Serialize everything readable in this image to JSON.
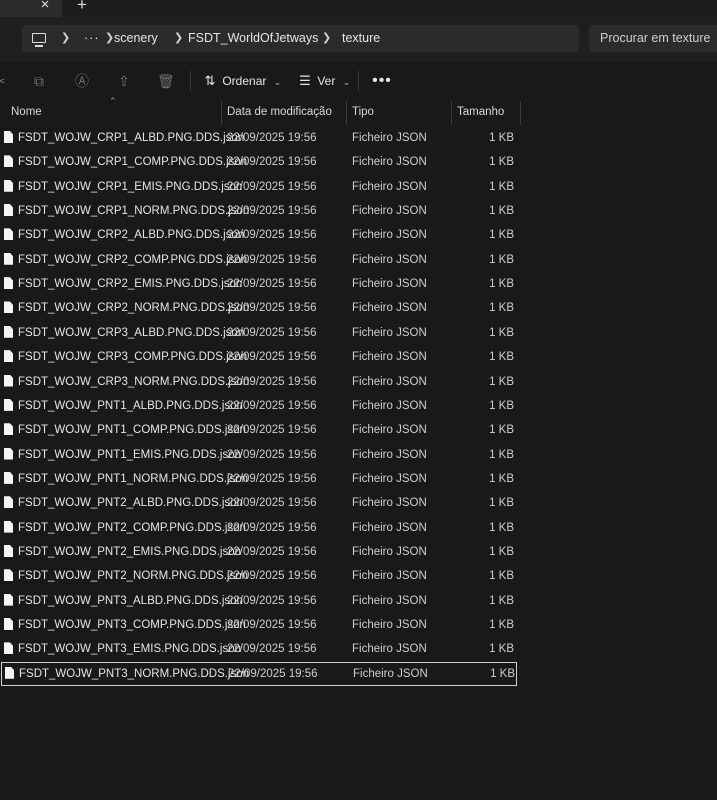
{
  "tabs": {
    "close_glyph": "×",
    "new_glyph": "+"
  },
  "address": {
    "overflow": "···",
    "crumbs": [
      "scenery",
      "FSDT_WorldOfJetways",
      "texture"
    ],
    "search_placeholder": "Procurar em texture"
  },
  "toolbar": {
    "sort_label": "Ordenar",
    "view_label": "Ver",
    "more_label": "•••"
  },
  "columns": {
    "name": "Nome",
    "date": "Data de modificação",
    "type": "Tipo",
    "size": "Tamanho"
  },
  "files": [
    {
      "name": "FSDT_WOJW_CRP1_ALBD.PNG.DDS.json",
      "date": "22/09/2025 19:56",
      "type": "Ficheiro JSON",
      "size": "1 KB"
    },
    {
      "name": "FSDT_WOJW_CRP1_COMP.PNG.DDS.json",
      "date": "22/09/2025 19:56",
      "type": "Ficheiro JSON",
      "size": "1 KB"
    },
    {
      "name": "FSDT_WOJW_CRP1_EMIS.PNG.DDS.json",
      "date": "22/09/2025 19:56",
      "type": "Ficheiro JSON",
      "size": "1 KB"
    },
    {
      "name": "FSDT_WOJW_CRP1_NORM.PNG.DDS.json",
      "date": "22/09/2025 19:56",
      "type": "Ficheiro JSON",
      "size": "1 KB"
    },
    {
      "name": "FSDT_WOJW_CRP2_ALBD.PNG.DDS.json",
      "date": "22/09/2025 19:56",
      "type": "Ficheiro JSON",
      "size": "1 KB"
    },
    {
      "name": "FSDT_WOJW_CRP2_COMP.PNG.DDS.json",
      "date": "22/09/2025 19:56",
      "type": "Ficheiro JSON",
      "size": "1 KB"
    },
    {
      "name": "FSDT_WOJW_CRP2_EMIS.PNG.DDS.json",
      "date": "22/09/2025 19:56",
      "type": "Ficheiro JSON",
      "size": "1 KB"
    },
    {
      "name": "FSDT_WOJW_CRP2_NORM.PNG.DDS.json",
      "date": "22/09/2025 19:56",
      "type": "Ficheiro JSON",
      "size": "1 KB"
    },
    {
      "name": "FSDT_WOJW_CRP3_ALBD.PNG.DDS.json",
      "date": "22/09/2025 19:56",
      "type": "Ficheiro JSON",
      "size": "1 KB"
    },
    {
      "name": "FSDT_WOJW_CRP3_COMP.PNG.DDS.json",
      "date": "22/09/2025 19:56",
      "type": "Ficheiro JSON",
      "size": "1 KB"
    },
    {
      "name": "FSDT_WOJW_CRP3_NORM.PNG.DDS.json",
      "date": "22/09/2025 19:56",
      "type": "Ficheiro JSON",
      "size": "1 KB"
    },
    {
      "name": "FSDT_WOJW_PNT1_ALBD.PNG.DDS.json",
      "date": "22/09/2025 19:56",
      "type": "Ficheiro JSON",
      "size": "1 KB"
    },
    {
      "name": "FSDT_WOJW_PNT1_COMP.PNG.DDS.json",
      "date": "22/09/2025 19:56",
      "type": "Ficheiro JSON",
      "size": "1 KB"
    },
    {
      "name": "FSDT_WOJW_PNT1_EMIS.PNG.DDS.json",
      "date": "22/09/2025 19:56",
      "type": "Ficheiro JSON",
      "size": "1 KB"
    },
    {
      "name": "FSDT_WOJW_PNT1_NORM.PNG.DDS.json",
      "date": "22/09/2025 19:56",
      "type": "Ficheiro JSON",
      "size": "1 KB"
    },
    {
      "name": "FSDT_WOJW_PNT2_ALBD.PNG.DDS.json",
      "date": "22/09/2025 19:56",
      "type": "Ficheiro JSON",
      "size": "1 KB"
    },
    {
      "name": "FSDT_WOJW_PNT2_COMP.PNG.DDS.json",
      "date": "22/09/2025 19:56",
      "type": "Ficheiro JSON",
      "size": "1 KB"
    },
    {
      "name": "FSDT_WOJW_PNT2_EMIS.PNG.DDS.json",
      "date": "22/09/2025 19:56",
      "type": "Ficheiro JSON",
      "size": "1 KB"
    },
    {
      "name": "FSDT_WOJW_PNT2_NORM.PNG.DDS.json",
      "date": "22/09/2025 19:56",
      "type": "Ficheiro JSON",
      "size": "1 KB"
    },
    {
      "name": "FSDT_WOJW_PNT3_ALBD.PNG.DDS.json",
      "date": "22/09/2025 19:56",
      "type": "Ficheiro JSON",
      "size": "1 KB"
    },
    {
      "name": "FSDT_WOJW_PNT3_COMP.PNG.DDS.json",
      "date": "22/09/2025 19:56",
      "type": "Ficheiro JSON",
      "size": "1 KB"
    },
    {
      "name": "FSDT_WOJW_PNT3_EMIS.PNG.DDS.json",
      "date": "22/09/2025 19:56",
      "type": "Ficheiro JSON",
      "size": "1 KB"
    },
    {
      "name": "FSDT_WOJW_PNT3_NORM.PNG.DDS.json",
      "date": "22/09/2025 19:56",
      "type": "Ficheiro JSON",
      "size": "1 KB",
      "selected": true
    }
  ]
}
